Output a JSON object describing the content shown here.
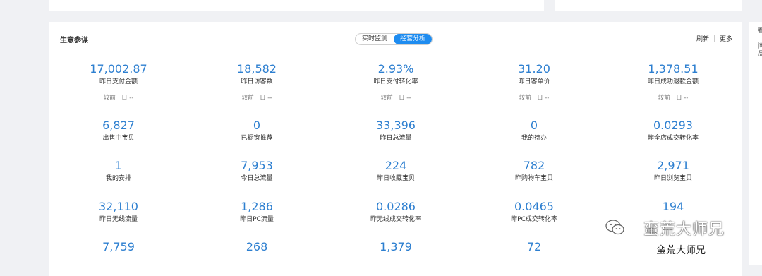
{
  "panel": {
    "title": "生意参谋",
    "tabs": [
      {
        "label": "实时监测",
        "active": false
      },
      {
        "label": "经营分析",
        "active": true
      }
    ],
    "actions": {
      "refresh": "刷新",
      "more": "更多"
    }
  },
  "metrics": [
    [
      {
        "value": "17,002.87",
        "label": "昨日支付金额",
        "compare": "较前一日 --"
      },
      {
        "value": "18,582",
        "label": "昨日访客数",
        "compare": "较前一日 --"
      },
      {
        "value": "2.93%",
        "label": "昨日支付转化率",
        "compare": "较前一日 --"
      },
      {
        "value": "31.20",
        "label": "昨日客单价",
        "compare": "较前一日 --"
      },
      {
        "value": "1,378.51",
        "label": "昨日成功退款金额",
        "compare": "较前一日 --"
      }
    ],
    [
      {
        "value": "6,827",
        "label": "出售中宝贝"
      },
      {
        "value": "0",
        "label": "已橱窗推荐"
      },
      {
        "value": "33,396",
        "label": "昨日总流量"
      },
      {
        "value": "0",
        "label": "我的待办"
      },
      {
        "value": "0.0293",
        "label": "昨全店成交转化率"
      }
    ],
    [
      {
        "value": "1",
        "label": "我的安排"
      },
      {
        "value": "7,953",
        "label": "今日总流量"
      },
      {
        "value": "224",
        "label": "昨日收藏宝贝"
      },
      {
        "value": "782",
        "label": "昨购物车宝贝"
      },
      {
        "value": "2,971",
        "label": "昨日浏览宝贝"
      }
    ],
    [
      {
        "value": "32,110",
        "label": "昨日无线流量"
      },
      {
        "value": "1,286",
        "label": "昨日PC流量"
      },
      {
        "value": "0.0286",
        "label": "昨无线成交转化率"
      },
      {
        "value": "0.0465",
        "label": "昨PC成交转化率"
      },
      {
        "value": "194",
        "label": ""
      }
    ],
    [
      {
        "value": "7,759",
        "label": ""
      },
      {
        "value": "268",
        "label": ""
      },
      {
        "value": "1,379",
        "label": ""
      },
      {
        "value": "72",
        "label": ""
      },
      {
        "value": "",
        "label": ""
      }
    ]
  ],
  "watermark": {
    "big": "蛮荒大师兄",
    "small": "蛮荒大师兄",
    "icon": "wechat-icon"
  },
  "right_strip": {
    "chars": [
      "看",
      "问",
      "品"
    ]
  },
  "colors": {
    "accent": "#1e8cf0",
    "value": "#2d7fd0",
    "background": "#f0f1f4"
  }
}
